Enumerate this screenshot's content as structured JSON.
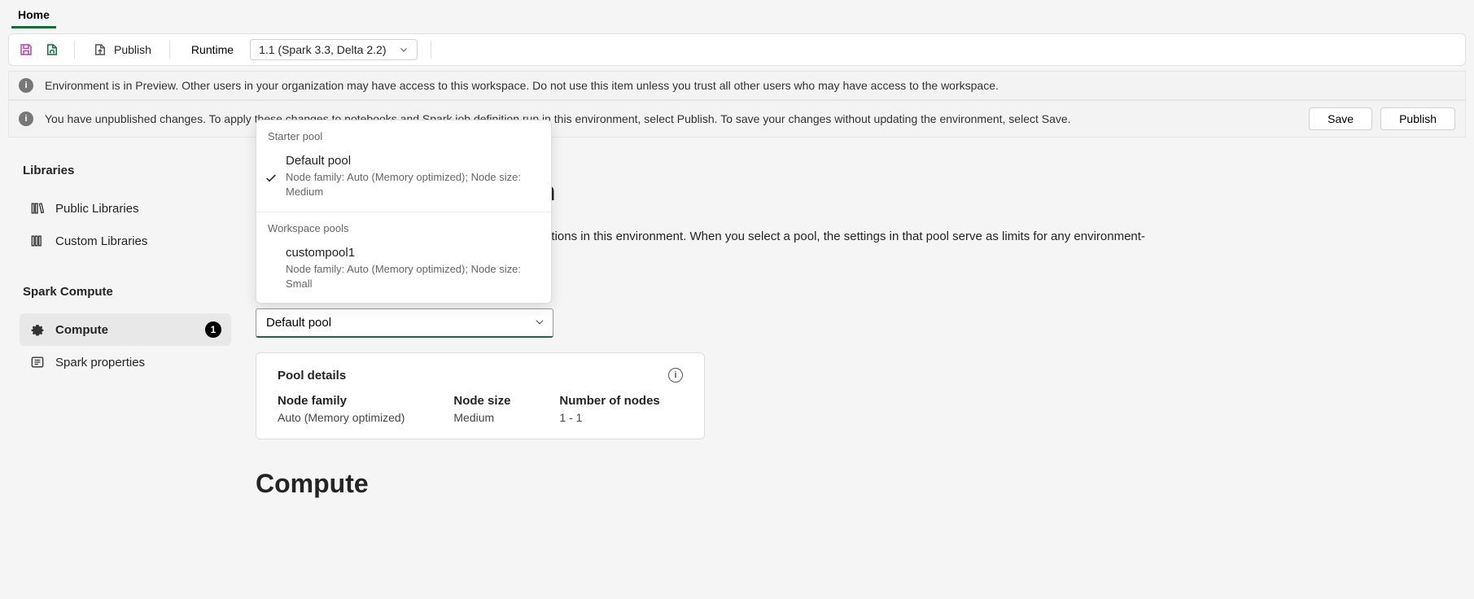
{
  "appbar": {
    "tab": "Home"
  },
  "toolbar": {
    "publish": "Publish",
    "runtime_label": "Runtime",
    "runtime_value": "1.1 (Spark 3.3, Delta 2.2)"
  },
  "banners": {
    "preview": "Environment is in Preview. Other users in your organization may have access to this workspace. Do not use this item unless you trust all other users who may have access to the workspace.",
    "unpublished": "You have unpublished changes. To apply these changes to notebooks and Spark job definition run in this environment, select Publish. To save your changes without updating the environment, select Save.",
    "save_btn": "Save",
    "publish_btn": "Publish"
  },
  "sidebar": {
    "libraries_heading": "Libraries",
    "public_libraries": "Public Libraries",
    "custom_libraries": "Custom Libraries",
    "spark_compute_heading": "Spark Compute",
    "compute": "Compute",
    "compute_badge": "1",
    "spark_properties": "Spark properties"
  },
  "page": {
    "title_suffix": "uration",
    "desc_suffix": "Spark job definitions in this environment. When you select a pool, the settings in that pool serve as limits for any environment-"
  },
  "pool_input": {
    "value": "Default pool"
  },
  "dropdown": {
    "starter_heading": "Starter pool",
    "default_name": "Default pool",
    "default_meta": "Node family: Auto (Memory optimized); Node size: Medium",
    "workspace_heading": "Workspace pools",
    "custom_name": "custompool1",
    "custom_meta": "Node family: Auto (Memory optimized); Node size: Small"
  },
  "details": {
    "title": "Pool details",
    "nodefamily_label": "Node family",
    "nodefamily_value": "Auto (Memory optimized)",
    "nodesize_label": "Node size",
    "nodesize_value": "Medium",
    "numnodes_label": "Number of nodes",
    "numnodes_value": "1 - 1"
  },
  "compute_section_title": "Compute"
}
